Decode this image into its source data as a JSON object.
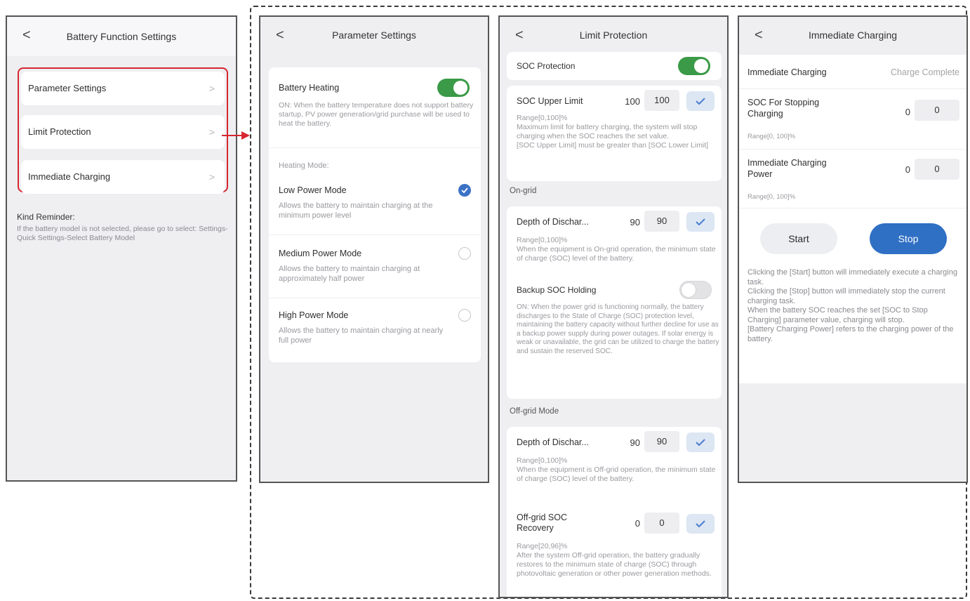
{
  "panel1": {
    "title": "Battery Function Settings",
    "back": "<",
    "items": [
      {
        "label": "Parameter Settings",
        "chevron": ">"
      },
      {
        "label": "Limit Protection",
        "chevron": ">"
      },
      {
        "label": "Immediate Charging",
        "chevron": ">"
      }
    ],
    "reminder_title": "Kind Reminder:",
    "reminder_text": "If the battery model is not selected, please go to select: Settings-Quick Settings-Select Battery Model"
  },
  "panel2": {
    "title": "Parameter Settings",
    "back": "<",
    "heating_label": "Battery Heating",
    "heating_on": true,
    "heating_desc": "ON: When the battery temperature does not support battery startup, PV power generation/grid purchase will be used to heat the battery.",
    "mode_section": "Heating Mode:",
    "modes": [
      {
        "label": "Low Power Mode",
        "desc": "Allows the battery to maintain charging at the minimum power level",
        "selected": true
      },
      {
        "label": "Medium Power Mode",
        "desc": "Allows the battery to maintain charging at approximately half power",
        "selected": false
      },
      {
        "label": "High Power Mode",
        "desc": "Allows the battery to maintain charging at nearly full power",
        "selected": false
      }
    ]
  },
  "panel3": {
    "title": "Limit Protection",
    "back": "<",
    "soc_protection_label": "SOC Protection",
    "soc_protection_on": true,
    "soc_upper": {
      "label": "SOC Upper Limit",
      "current": "100",
      "value": "100",
      "desc": "Range[0,100]%\nMaximum limit for battery charging, the system will stop charging when the SOC reaches the set value.\n[SOC Upper Limit] must be greater than [SOC Lower Limit]"
    },
    "on_grid_section": "On-grid",
    "on_grid_dod": {
      "label": "Depth of Dischar...",
      "current": "90",
      "value": "90",
      "desc": "Range[0,100]%\nWhen the equipment is On-grid operation, the minimum state of charge (SOC) level of the battery."
    },
    "backup_soc": {
      "label": "Backup SOC Holding",
      "on": false,
      "desc": "ON: When the power grid is functioning normally, the battery discharges to the State of Charge (SOC) protection level, maintaining the battery capacity without further decline for use as a backup power supply during power outages. If solar energy is weak or unavailable, the grid can be utilized to charge the battery and sustain the reserved SOC."
    },
    "off_grid_section": "Off-grid Mode",
    "off_grid_dod": {
      "label": "Depth of Dischar...",
      "current": "90",
      "value": "90",
      "desc": "Range[0,100]%\nWhen the equipment is Off-grid operation, the minimum state of charge (SOC) level of the battery."
    },
    "off_grid_recovery": {
      "label": "Off-grid SOC Recovery",
      "current": "0",
      "value": "0",
      "desc": "Range[20,96]%\nAfter the system Off-grid operation, the battery gradually restores to the minimum state of charge (SOC) through photovoltaic generation or other power generation methods."
    }
  },
  "panel4": {
    "title": "Immediate Charging",
    "back": "<",
    "status_label": "Immediate Charging",
    "status_value": "Charge Complete",
    "soc_stop": {
      "label": "SOC For Stopping Charging",
      "current": "0",
      "value": "0",
      "range": "Range[0, 100]%"
    },
    "power": {
      "label": "Immediate Charging Power",
      "current": "0",
      "value": "0",
      "range": "Range[0, 100]%"
    },
    "start_label": "Start",
    "stop_label": "Stop",
    "notes": "Clicking the [Start] button will immediately execute a charging task.\nClicking the [Stop] button will immediately stop the current charging task.\nWhen the battery SOC reaches the set [SOC to Stop Charging] parameter value, charging will stop.\n[Battery Charging Power] refers to the charging power of the battery."
  },
  "colors": {
    "toggle_on": "#3a9a47",
    "highlight_red": "#d6262f",
    "primary_blue": "#2f6fc4",
    "check_blue": "#4a7fd0"
  },
  "icons": {
    "back": "chevron-left-icon",
    "row": "chevron-right-icon",
    "confirm": "checkmark-icon",
    "selected": "check-circle-icon",
    "unselected": "radio-empty-icon",
    "pointer": "arrow-right-icon"
  }
}
